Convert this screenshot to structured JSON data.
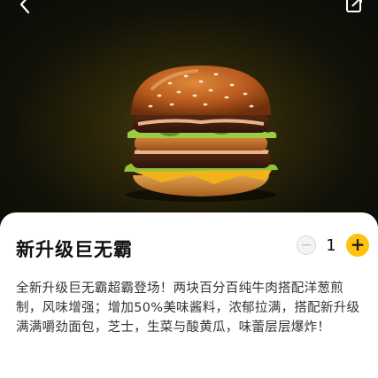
{
  "hero": {
    "image": "big-mac-burger",
    "back_icon": "back-arrow-icon",
    "share_icon": "share-icon",
    "background_color": "#0b0b08"
  },
  "product": {
    "title": "新升级巨无霸",
    "description": "全新升级巨无霸超霸登场！两块百分百纯牛肉搭配洋葱煎制，风味增强；增加50%美味酱料，浓郁拉满，搭配新升级满满嚼劲面包，芝士，生菜与酸黄瓜，味蕾层层爆炸！"
  },
  "stepper": {
    "minus_label": "−",
    "quantity": "1",
    "plus_label": "+",
    "accent_color": "#ffc20e"
  }
}
